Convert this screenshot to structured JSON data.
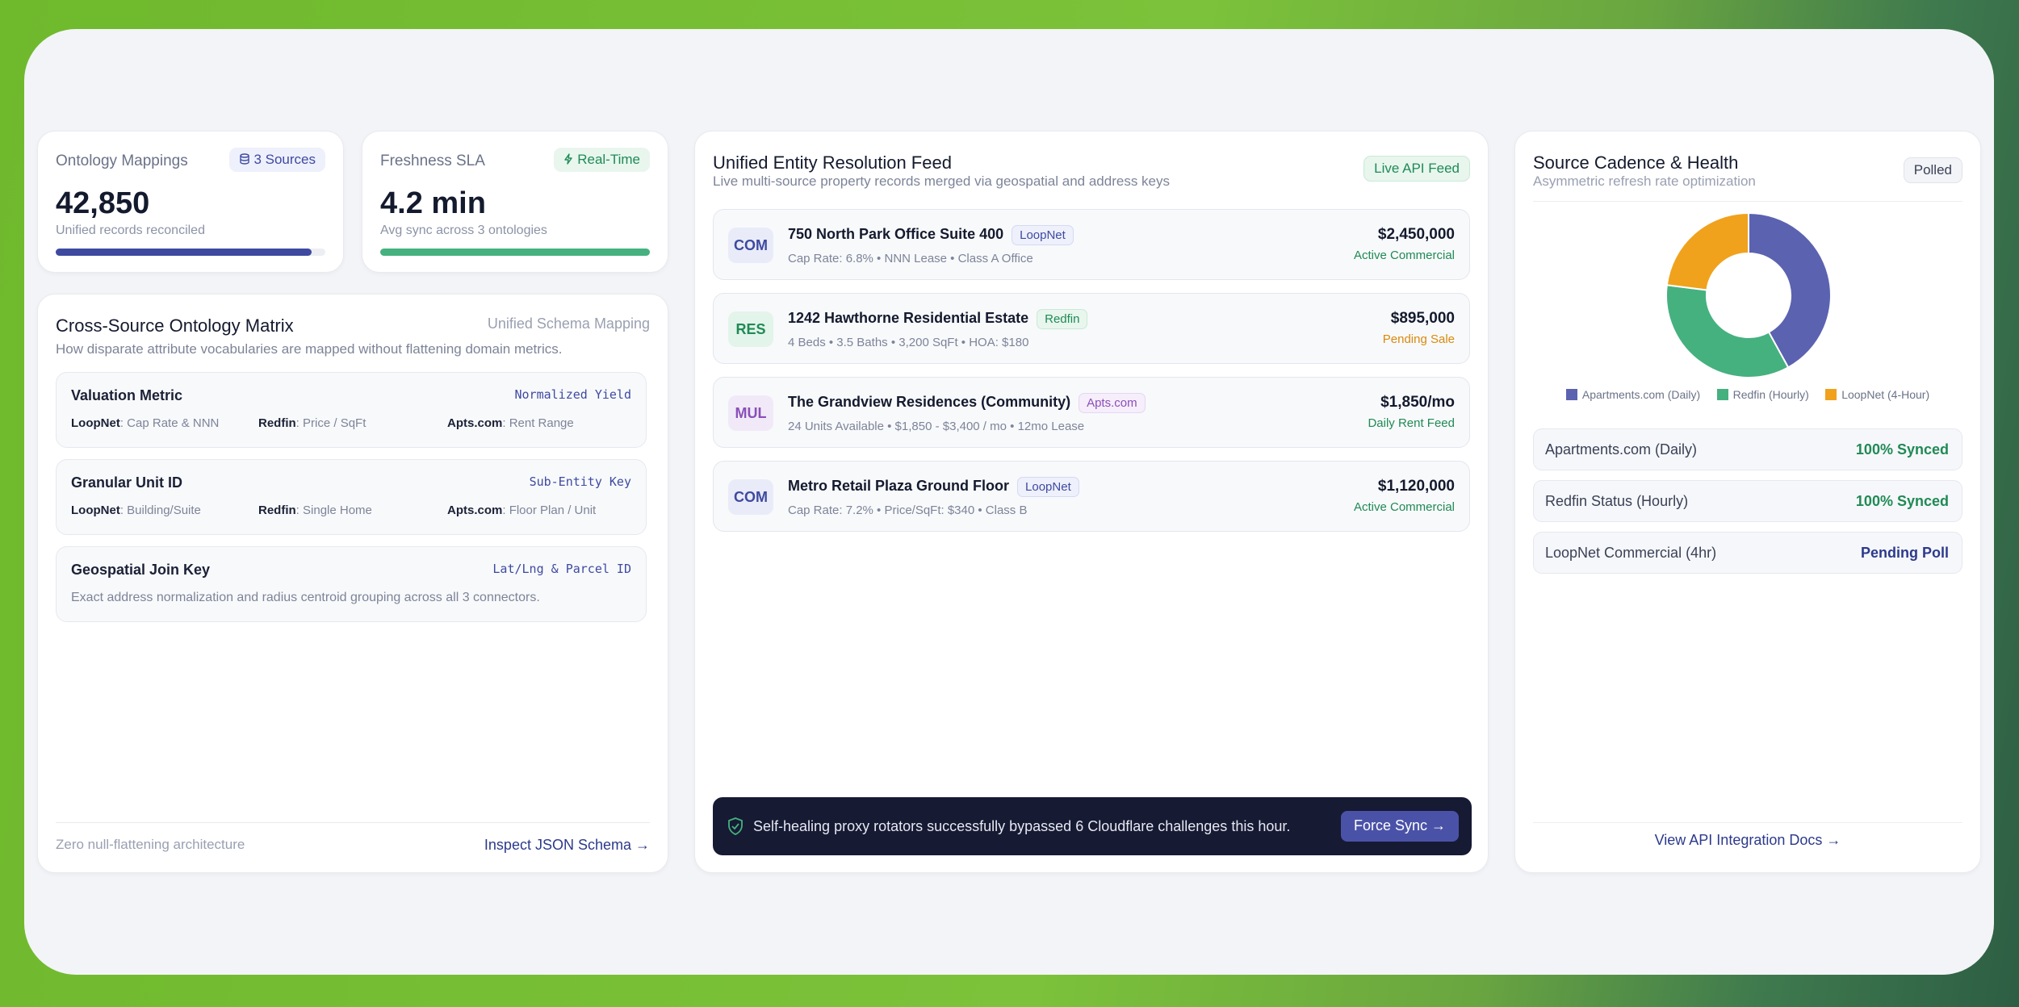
{
  "kpi": {
    "ontology": {
      "label": "Ontology Mappings",
      "pill": "3 Sources",
      "value": "42,850",
      "sub": "Unified records reconciled",
      "progress": 0.95
    },
    "freshness": {
      "label": "Freshness SLA",
      "pill": "Real-Time",
      "value": "4.2 min",
      "sub": "Avg sync across 3 ontologies",
      "progress": 1.0
    }
  },
  "matrix": {
    "title": "Cross-Source Ontology Matrix",
    "tag": "Unified Schema Mapping",
    "subtitle": "How disparate attribute vocabularies are mapped without flattening domain metrics.",
    "rows": [
      {
        "title": "Valuation Metric",
        "key": "Normalized Yield",
        "fields": [
          {
            "src": "LoopNet",
            "val": "Cap Rate & NNN"
          },
          {
            "src": "Redfin",
            "val": "Price / SqFt"
          },
          {
            "src": "Apts.com",
            "val": "Rent Range"
          }
        ]
      },
      {
        "title": "Granular Unit ID",
        "key": "Sub-Entity Key",
        "fields": [
          {
            "src": "LoopNet",
            "val": "Building/Suite"
          },
          {
            "src": "Redfin",
            "val": "Single Home"
          },
          {
            "src": "Apts.com",
            "val": "Floor Plan / Unit"
          }
        ]
      },
      {
        "title": "Geospatial Join Key",
        "key": "Lat/Lng & Parcel ID",
        "desc": "Exact address normalization and radius centroid grouping across all 3 connectors."
      }
    ],
    "footer_note": "Zero null-flattening architecture",
    "footer_link": "Inspect JSON Schema →"
  },
  "feed": {
    "title": "Unified Entity Resolution Feed",
    "subtitle": "Live multi-source property records merged via geospatial and address keys",
    "pill": "Live API Feed",
    "items": [
      {
        "badge": "COM",
        "name": "750 North Park Office Suite 400",
        "source": "LoopNet",
        "meta": "Cap Rate: 6.8% • NNN Lease • Class A Office",
        "price": "$2,450,000",
        "status": "Active Commercial"
      },
      {
        "badge": "RES",
        "name": "1242 Hawthorne Residential Estate",
        "source": "Redfin",
        "meta": "4 Beds • 3.5 Baths • 3,200 SqFt • HOA: $180",
        "price": "$895,000",
        "status": "Pending Sale"
      },
      {
        "badge": "MUL",
        "name": "The Grandview Residences (Community)",
        "source": "Apts.com",
        "meta": "24 Units Available • $1,850 - $3,400 / mo • 12mo Lease",
        "price": "$1,850/mo",
        "status": "Daily Rent Feed"
      },
      {
        "badge": "COM",
        "name": "Metro Retail Plaza Ground Floor",
        "source": "LoopNet",
        "meta": "Cap Rate: 7.2% • Price/SqFt: $340 • Class B",
        "price": "$1,120,000",
        "status": "Active Commercial"
      }
    ],
    "banner_text": "Self-healing proxy rotators successfully bypassed 6 Cloudflare challenges this hour.",
    "banner_button": "Force Sync →"
  },
  "health": {
    "title": "Source Cadence & Health",
    "subtitle": "Asymmetric refresh rate optimization",
    "pill": "Polled",
    "chart": {
      "series": [
        {
          "name": "Apartments.com (Daily)",
          "value": 42,
          "color": "#5b62b0"
        },
        {
          "name": "Redfin (Hourly)",
          "value": 35,
          "color": "#45b17f"
        },
        {
          "name": "LoopNet (4-Hour)",
          "value": 23,
          "color": "#f0a21c"
        }
      ]
    },
    "rows": [
      {
        "label": "Apartments.com (Daily)",
        "status": "100% Synced",
        "color": "#1f8a55"
      },
      {
        "label": "Redfin Status (Hourly)",
        "status": "100% Synced",
        "color": "#1f8a55"
      },
      {
        "label": "LoopNet Commercial (4hr)",
        "status": "Pending Poll",
        "color": "#2c3a8c"
      }
    ],
    "footer_link": "View API Integration Docs →"
  }
}
